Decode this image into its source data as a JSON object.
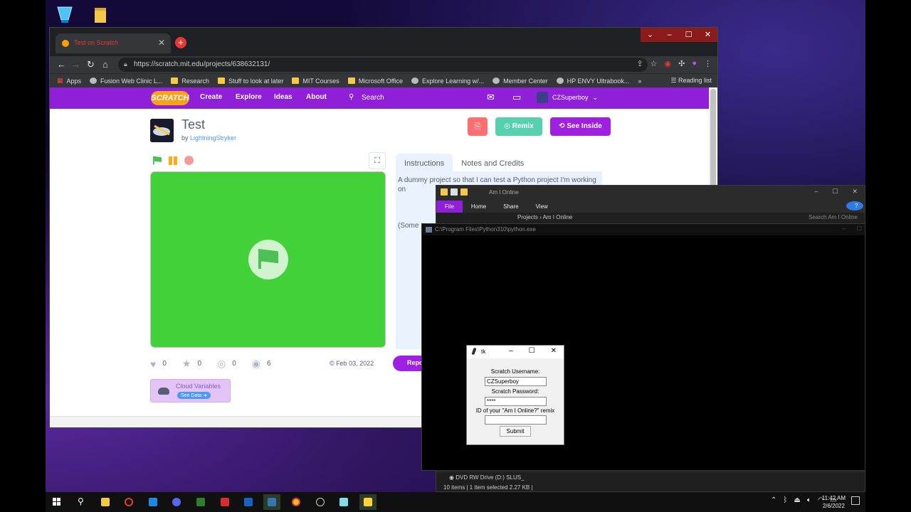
{
  "browser": {
    "tab_title": "Test on Scratch",
    "url": "https://scratch.mit.edu/projects/638632131/",
    "bookmarks": [
      "Apps",
      "Fusion Web Clinic L...",
      "Research",
      "Stuff to look at later",
      "MIT Courses",
      "Microsoft Office",
      "Explore Learning w/...",
      "Member Center",
      "HP ENVY Ultrabook..."
    ],
    "reading_list": "Reading list",
    "more": "»"
  },
  "scratch_nav": {
    "logo": "SCRATCH",
    "links": [
      "Create",
      "Explore",
      "Ideas",
      "About"
    ],
    "search_placeholder": "Search",
    "username": "CZSuperboy"
  },
  "project": {
    "title": "Test",
    "by_prefix": "by ",
    "author": "LightningStryker",
    "remix_label": "Remix",
    "see_inside_label": "See Inside",
    "tabs": [
      "Instructions",
      "Notes and Credits"
    ],
    "instructions": "A dummy project so that I can test a Python project I'm working on",
    "notes_partial": "(Some",
    "stats": {
      "loves": "0",
      "favorites": "0",
      "remixes": "0",
      "views": "6"
    },
    "shared_date": "Feb 03, 2022",
    "report_label": "Repo",
    "cloud_label": "Cloud Variables",
    "see_data_label": "See Data"
  },
  "explorer": {
    "title": "Am I Online",
    "ribbon": [
      "File",
      "Home",
      "Share",
      "View"
    ],
    "address": "Projects  ›  Am I Online",
    "search_placeholder": "Search Am I Online",
    "drive": "DVD RW Drive (D:) SLUS_",
    "status": "10 items  |  1 item selected  2.27 KB  |"
  },
  "console": {
    "title": "C:\\Program Files\\Python310\\python.exe"
  },
  "tk": {
    "title": "tk",
    "username_label": "Scratch Username:",
    "username_value": "CZSuperboy",
    "password_label": "Scratch Password:",
    "password_value": "****",
    "remix_label": "ID of your \"Am I Online?\" remix",
    "remix_value": "",
    "submit_label": "Submit"
  },
  "taskbar": {
    "time": "11:42 AM",
    "date": "2/6/2022"
  },
  "colors": {
    "scratch_purple": "#8f20d8",
    "stage_green": "#43d13a",
    "remix_green": "#0fbd8c"
  }
}
